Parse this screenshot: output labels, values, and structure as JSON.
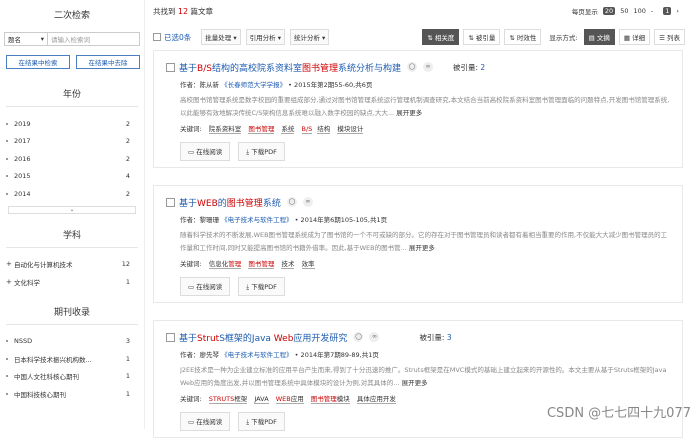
{
  "sidebar": {
    "secondary_search": "二次检索",
    "field_select": "题名",
    "input_placeholder": "请输入检索词",
    "btn_search_in": "在结果中检索",
    "btn_exclude": "在结果中去除",
    "sections": [
      {
        "title": "年份",
        "items": [
          {
            "label": "2019",
            "count": "2"
          },
          {
            "label": "2017",
            "count": "2"
          },
          {
            "label": "2016",
            "count": "2"
          },
          {
            "label": "2015",
            "count": "4"
          },
          {
            "label": "2014",
            "count": "2"
          }
        ]
      },
      {
        "title": "学科",
        "items": [
          {
            "label": "自动化与计算机技术",
            "count": "12"
          },
          {
            "label": "文化科学",
            "count": "1"
          }
        ]
      },
      {
        "title": "期刊收录",
        "items": [
          {
            "label": "NSSD",
            "count": "3"
          },
          {
            "label": "日本科学技术振兴机构数...",
            "count": "1"
          },
          {
            "label": "中国人文社科核心期刊",
            "count": "1"
          },
          {
            "label": "中国科技核心期刊",
            "count": "1"
          }
        ]
      }
    ]
  },
  "header": {
    "total_prefix": "共找到",
    "total_num": "12",
    "total_suffix": "篇文章",
    "perpage_label": "每页显示",
    "perpage_selected": "20",
    "perpage_opt1": "50",
    "perpage_opt2": "100",
    "page_sep": "-",
    "page_num": "1"
  },
  "toolbar": {
    "selected": "已选0条",
    "batch": "批量处理 ▾",
    "cite": "引用分析 ▾",
    "stats": "统计分析 ▾",
    "sort_relevance": "相关度",
    "sort_cited": "被引量",
    "sort_time": "时效性",
    "mode_label": "显示方式:",
    "mode_abstract": "文摘",
    "mode_detail": "详细",
    "mode_list": "列表"
  },
  "results": [
    {
      "title_parts": [
        "基于",
        "B/S",
        "结构的高校院系资料室",
        "图书管理",
        "系统分析与构建"
      ],
      "cited_label": "被引量:",
      "cited_num": "2",
      "author_label": "作者：",
      "author": "陈从新",
      "journal": "《长春师范大学学报》",
      "issue": "• 2015年第2期55-60,共6页",
      "abstract": "高校图书馆管理系统是数字校园的重要组成部分,通过对图书馆管理系统运行管理机制调查研究,本文结合当前高校院系资料室图书管理面临的问题特点,开发图书馆管理系统,以此能够有效地解决传统C/S架构信息系统难以融入数字校园的缺点,大大...",
      "more": "展开更多",
      "kw_label": "关键词:",
      "keywords": [
        {
          "text": "院系资料室",
          "hl": false
        },
        {
          "text": "图书管理",
          "hl": true
        },
        {
          "text": "系统",
          "hl": false
        },
        {
          "text": "B/S",
          "hl": true
        },
        {
          "text": "结构",
          "hl": false
        },
        {
          "text": "模块设计",
          "hl": false
        }
      ],
      "read": "在线阅读",
      "download": "下载PDF"
    },
    {
      "title_parts": [
        "基于",
        "WEB",
        "的",
        "图书管理",
        "系统"
      ],
      "cited_label": "",
      "cited_num": "",
      "author_label": "作者：",
      "author": "黎珊珊",
      "journal": "《电子技术与软件工程》",
      "issue": "• 2014年第6期105-105,共1页",
      "abstract": "随着科学技术的不断发展,WEB图书管理系统成为了图书馆的一个不可或缺的部分。它的存在对于图书管理员和读者都有着相当重要的作用,不仅能大大减少图书管理员的工作量和工作时间,同时又能提高图书馆的书籍外借率。因此,基于WEB的图书管...",
      "more": "展开更多",
      "kw_label": "关键词:",
      "keywords": [
        {
          "text": "信息化",
          "hl": false
        },
        {
          "text": "管理",
          "hl": true
        },
        {
          "text": "图书管理",
          "hl": true
        },
        {
          "text": "技术",
          "hl": false
        },
        {
          "text": "效率",
          "hl": false
        }
      ],
      "read": "在线阅读",
      "download": "下载PDF"
    },
    {
      "title_parts": [
        "基于",
        "Strut",
        "S框架的Java ",
        "Web",
        "应用开发研究"
      ],
      "cited_label": "被引量:",
      "cited_num": "3",
      "author_label": "作者：",
      "author": "廖先琴",
      "journal": "《电子技术与软件工程》",
      "issue": "• 2014年第7期89-89,共1页",
      "abstract": "J2EE技术是一种为企业建立标准的应用平台产生而来,得到了十分迅速的推广。Struts框架是在MVC模式的基础上建立起来的开源性的。本文主要从基于Struts框架的Java Web应用的角度出发,并以图书管理系统中具体模块的设计为例,对其具体的...",
      "more": "展开更多",
      "kw_label": "关键词:",
      "keywords": [
        {
          "text": "STRUTS",
          "hl": true
        },
        {
          "text": "框架",
          "hl": false
        },
        {
          "text": "JAVA",
          "hl": false
        },
        {
          "text": "WEB",
          "hl": true
        },
        {
          "text": "应用",
          "hl": false
        },
        {
          "text": "图书管理",
          "hl": true
        },
        {
          "text": "模块",
          "hl": false
        },
        {
          "text": "具体应用开发",
          "hl": false
        }
      ],
      "read": "在线阅读",
      "download": "下载PDF"
    }
  ],
  "watermark": "CSDN @七七四十九077"
}
